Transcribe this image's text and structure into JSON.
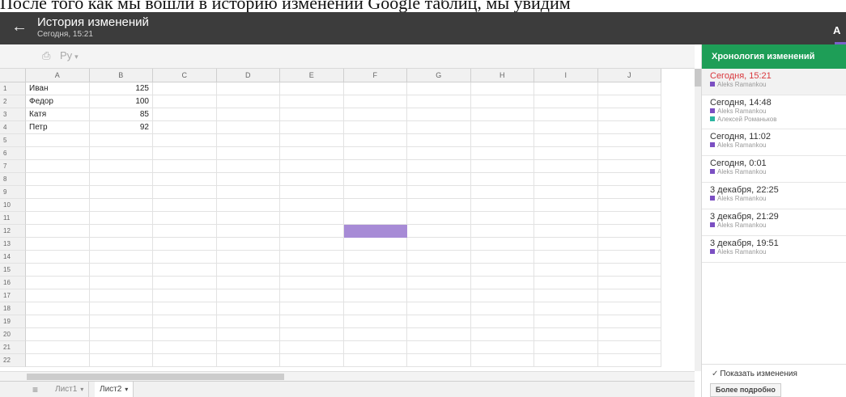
{
  "caption": "После того как мы вошли в историю изменений Google таблиц, мы увидим",
  "header": {
    "title": "История изменений",
    "subtitle": "Сегодня, 15:21",
    "right_label": "A"
  },
  "toolbar": {
    "font_name": "Ру",
    "icons": [
      "print-icon",
      "chevron-down-icon"
    ]
  },
  "grid": {
    "columns": [
      "A",
      "B",
      "C",
      "D",
      "E",
      "F",
      "G",
      "H",
      "I",
      "J"
    ],
    "rows": [
      "1",
      "2",
      "3",
      "4",
      "5",
      "6",
      "7",
      "8",
      "9",
      "10",
      "11",
      "12",
      "13",
      "14",
      "15",
      "16",
      "17",
      "18",
      "19",
      "20",
      "21",
      "22"
    ],
    "data": [
      [
        "Иван",
        "125"
      ],
      [
        "Федор",
        "100"
      ],
      [
        "Катя",
        "85"
      ],
      [
        "Петр",
        "92"
      ]
    ],
    "highlight": {
      "column": "F",
      "row": "12",
      "color": "#a78bd6"
    }
  },
  "sheets": {
    "tabs": [
      {
        "label": "Лист1",
        "active": false
      },
      {
        "label": "Лист2",
        "active": true
      }
    ]
  },
  "panel": {
    "title": "Хронология изменений",
    "header_color": "#1e9e57",
    "revisions": [
      {
        "time": "Сегодня, 15:21",
        "selected": true,
        "authors": [
          {
            "name": "Aleks Ramankou",
            "color": "#7b4fc2"
          }
        ]
      },
      {
        "time": "Сегодня, 14:48",
        "selected": false,
        "authors": [
          {
            "name": "Aleks Ramankou",
            "color": "#7b4fc2"
          },
          {
            "name": "Алексей Романьков",
            "color": "#2bb5a0"
          }
        ]
      },
      {
        "time": "Сегодня, 11:02",
        "selected": false,
        "authors": [
          {
            "name": "Aleks Ramankou",
            "color": "#7b4fc2"
          }
        ]
      },
      {
        "time": "Сегодня, 0:01",
        "selected": false,
        "authors": [
          {
            "name": "Aleks Ramankou",
            "color": "#7b4fc2"
          }
        ]
      },
      {
        "time": "3 декабря, 22:25",
        "selected": false,
        "authors": [
          {
            "name": "Aleks Ramankou",
            "color": "#7b4fc2"
          }
        ]
      },
      {
        "time": "3 декабря, 21:29",
        "selected": false,
        "authors": [
          {
            "name": "Aleks Ramankou",
            "color": "#7b4fc2"
          }
        ]
      },
      {
        "time": "3 декабря, 19:51",
        "selected": false,
        "authors": [
          {
            "name": "Aleks Ramankou",
            "color": "#7b4fc2"
          }
        ]
      }
    ],
    "show_changes_label": "Показать изменения",
    "show_changes_checked": true,
    "more_label": "Более подробно"
  }
}
